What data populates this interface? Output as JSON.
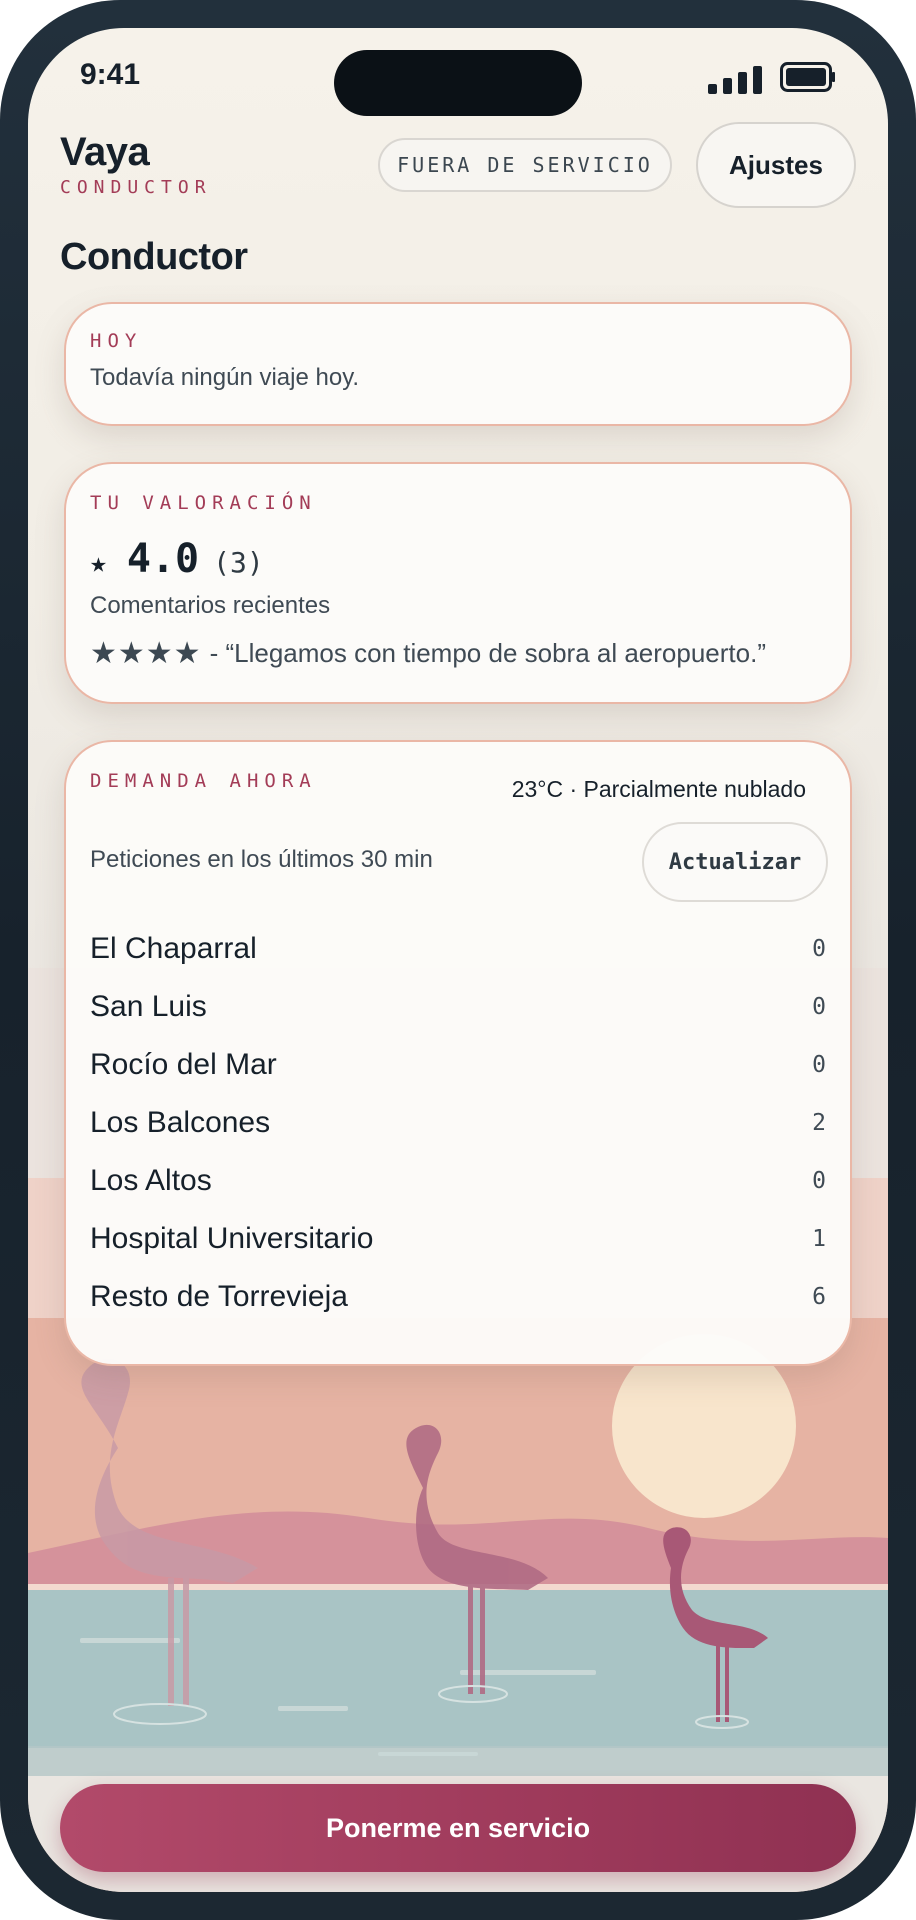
{
  "status_bar": {
    "time": "9:41"
  },
  "header": {
    "brand_name": "Vaya",
    "brand_sub": "CONDUCTOR",
    "status_pill": "FUERA DE SERVICIO",
    "settings_label": "Ajustes"
  },
  "page_title": "Conductor",
  "today": {
    "kicker": "HOY",
    "message": "Todavía ningún viaje hoy."
  },
  "rating": {
    "kicker": "TU VALORACIÓN",
    "star": "★",
    "value": "4.0",
    "count": "(3)",
    "recent_label": "Comentarios recientes",
    "review_stars": "★★★★",
    "review_text": " - “Llegamos con tiempo de sobra al aeropuerto.”"
  },
  "demand": {
    "kicker": "DEMANDA AHORA",
    "weather": "23°C · Parcialmente nublado",
    "subtitle": "Peticiones en los últimos 30 min",
    "refresh_label": "Actualizar",
    "zones": [
      {
        "name": "El Chaparral",
        "count": "0"
      },
      {
        "name": "San Luis",
        "count": "0"
      },
      {
        "name": "Rocío del Mar",
        "count": "0"
      },
      {
        "name": "Los Balcones",
        "count": "2"
      },
      {
        "name": "Los Altos",
        "count": "0"
      },
      {
        "name": "Hospital Universitario",
        "count": "1"
      },
      {
        "name": "Resto de Torrevieja",
        "count": "6"
      }
    ]
  },
  "primary_action": "Ponerme en servicio",
  "colors": {
    "accent": "#a33c57",
    "primary_button": "#a8445f",
    "text_dark": "#16202a",
    "lagoon": "#a9c4c5",
    "flamingo": "#b7738a"
  }
}
